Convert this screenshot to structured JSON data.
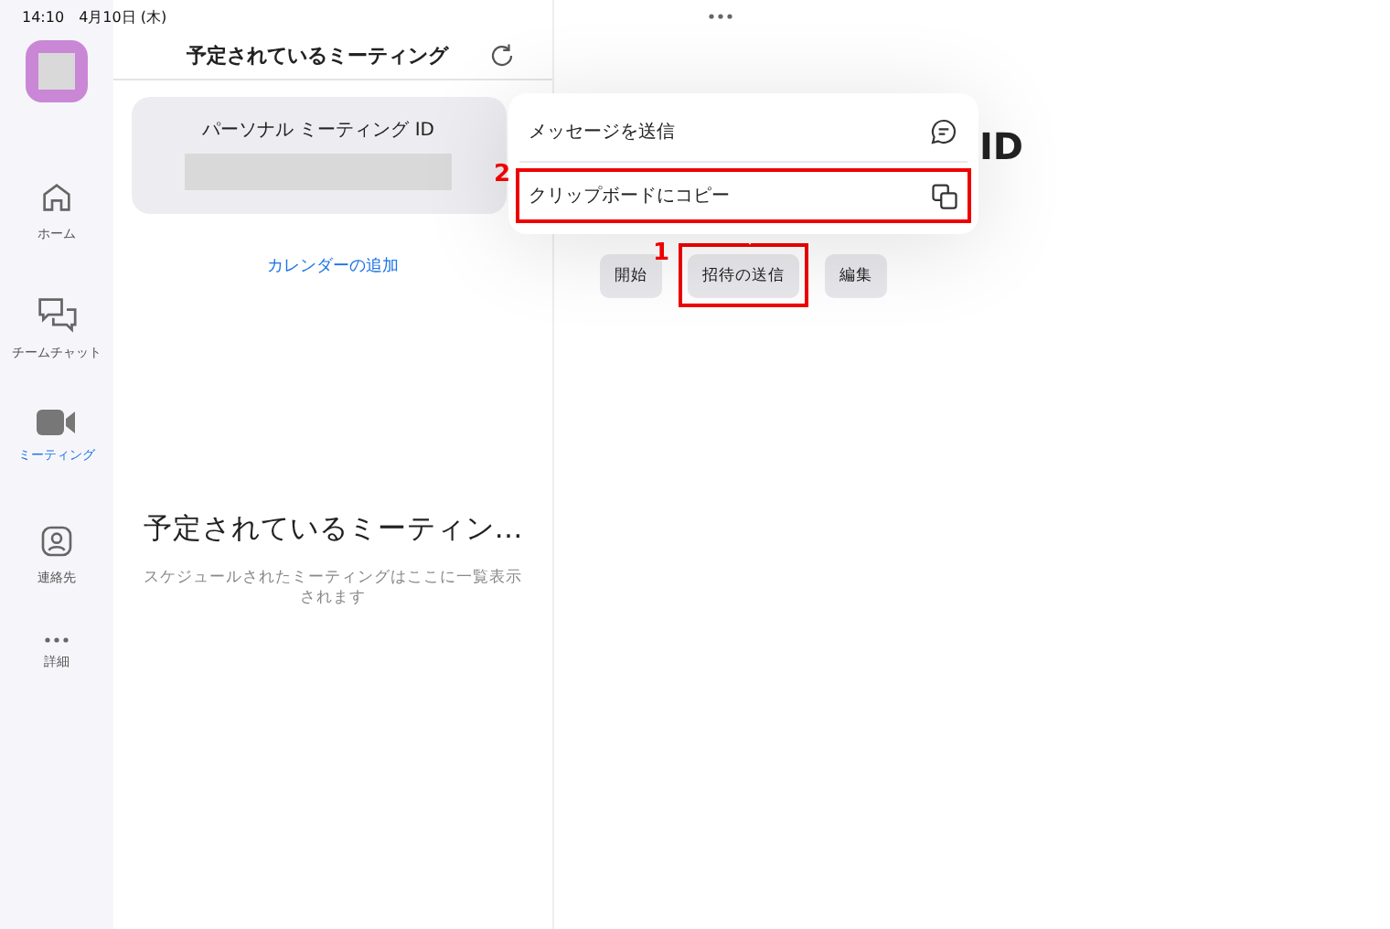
{
  "status_bar": {
    "time": "14:10",
    "date": "4月10日 (木)"
  },
  "sidebar": {
    "items": [
      {
        "label": "ホーム",
        "kind": "home",
        "selected": false
      },
      {
        "label": "チームチャット",
        "kind": "chat",
        "selected": false
      },
      {
        "label": "ミーティング",
        "kind": "video",
        "selected": true
      },
      {
        "label": "連絡先",
        "kind": "contact",
        "selected": false
      },
      {
        "label": "詳細",
        "kind": "more",
        "selected": false
      }
    ]
  },
  "list_panel": {
    "title": "予定されているミーティング",
    "pmi_card": {
      "title": "パーソナル ミーティング ID"
    },
    "calendar_link": "カレンダーの追加",
    "empty_title": "予定されているミーティン…",
    "empty_text": "スケジュールされたミーティングはここに一覧表示されます"
  },
  "detail_panel": {
    "title": "ID",
    "buttons": [
      {
        "label": "開始",
        "highlighted": false
      },
      {
        "label": "招待の送信",
        "highlighted": true
      },
      {
        "label": "編集",
        "highlighted": false
      }
    ]
  },
  "popup_menu": {
    "items": [
      {
        "label": "メッセージを送信",
        "kind": "message",
        "highlighted": false
      },
      {
        "label": "クリップボードにコピー",
        "kind": "copy",
        "highlighted": true
      }
    ]
  },
  "annotations": {
    "button_step": "1",
    "menu_step": "2"
  }
}
